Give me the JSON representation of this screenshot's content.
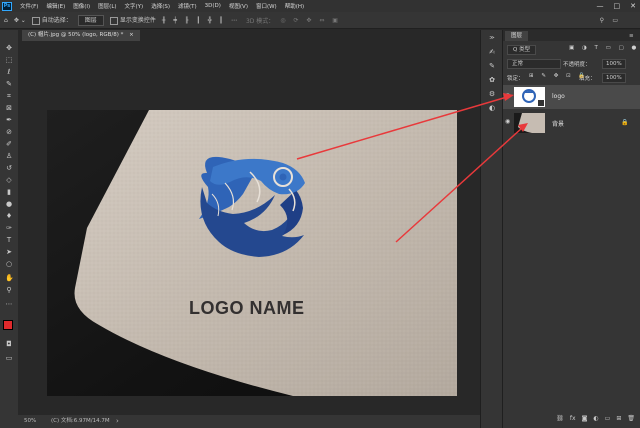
{
  "menu": {
    "logo": "Ps",
    "items": [
      "文件(F)",
      "编辑(E)",
      "图像(I)",
      "图层(L)",
      "文字(Y)",
      "选择(S)",
      "滤镜(T)",
      "3D(D)",
      "视图(V)",
      "窗口(W)",
      "帮助(H)"
    ],
    "window_controls": [
      "—",
      "□",
      "✕"
    ]
  },
  "options": {
    "auto_select": "自动选择：",
    "target": "图层",
    "show_transform": "显示变换控件",
    "mode_3d": "3D 模式："
  },
  "document": {
    "tab_title": "(C) 帽片.jpg @ 50% (logo, RGB/8) *",
    "tab_close": "×",
    "logo_text": "LOGO NAME"
  },
  "status": {
    "zoom": "50%",
    "doc_info": "(C) 文档:6.97M/14.7M",
    "arrow": "›"
  },
  "layers_panel": {
    "tab": "图层",
    "filter_kind": "Q 类型",
    "blend_mode": "正常",
    "opacity_label": "不透明度：",
    "opacity": "100%",
    "lock_label": "锁定：",
    "fill_label": "填充：",
    "fill": "100%",
    "layers": [
      {
        "name": "logo",
        "selected": true
      },
      {
        "name": "背景",
        "selected": false
      }
    ],
    "bottom_icons": [
      "link-icon",
      "fx-icon",
      "mask-icon",
      "adjustment-icon",
      "group-icon",
      "new-layer-icon",
      "trash-icon"
    ]
  },
  "colors": {
    "foreground": "#e0292c",
    "background": "#ffffff",
    "logo_blue": "#2f64b7",
    "arrow_red": "#e8393b",
    "card": "#c6bcb2"
  }
}
